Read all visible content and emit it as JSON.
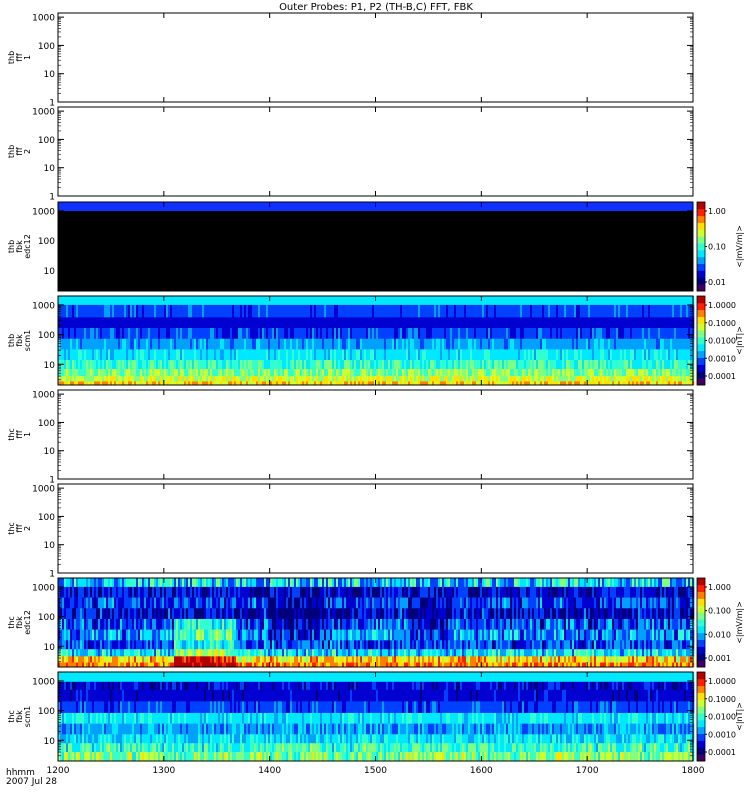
{
  "title": "Outer Probes: P1, P2 (TH-B,C) FFT, FBK",
  "xaxis": {
    "range": [
      1200,
      1800
    ],
    "ticks": [
      "1200",
      "1300",
      "1400",
      "1500",
      "1600",
      "1700",
      "1800"
    ],
    "label_line1": "hhmm",
    "label_line2": "2007 Jul 28"
  },
  "chart_data": [
    {
      "type": "heatmap",
      "name_lines": [
        "thb",
        "fff",
        "1"
      ],
      "yticks": [
        "1",
        "10",
        "100",
        "1000"
      ],
      "ylim": [
        1,
        1400
      ],
      "fill": "none",
      "colorbar": null
    },
    {
      "type": "heatmap",
      "name_lines": [
        "thb",
        "fff",
        "2"
      ],
      "yticks": [
        "1",
        "10",
        "100",
        "1000"
      ],
      "ylim": [
        1,
        1400
      ],
      "fill": "none",
      "colorbar": null
    },
    {
      "type": "heatmap",
      "name_lines": [
        "thb",
        "fbk",
        "edc12"
      ],
      "yticks": [
        "10",
        "100",
        "1000"
      ],
      "ylim": [
        2,
        2000
      ],
      "fill": "edc_black",
      "colorbar": {
        "ticks": [
          "1.00",
          "0.10",
          "0.01"
        ],
        "unit": "<|mV/m|>"
      }
    },
    {
      "type": "heatmap",
      "name_lines": [
        "thb",
        "fbk",
        "scm1"
      ],
      "yticks": [
        "10",
        "100",
        "1000"
      ],
      "ylim": [
        2,
        2000
      ],
      "fill": "scm_b",
      "colorbar": {
        "ticks": [
          "1.0000",
          "0.1000",
          "0.0100",
          "0.0010",
          "0.0001"
        ],
        "unit": "<|nT|>"
      }
    },
    {
      "type": "heatmap",
      "name_lines": [
        "thc",
        "fff",
        "1"
      ],
      "yticks": [
        "1",
        "10",
        "100",
        "1000"
      ],
      "ylim": [
        1,
        1400
      ],
      "fill": "none",
      "colorbar": null
    },
    {
      "type": "heatmap",
      "name_lines": [
        "thc",
        "fff",
        "2"
      ],
      "yticks": [
        "1",
        "10",
        "100",
        "1000"
      ],
      "ylim": [
        1,
        1400
      ],
      "fill": "none",
      "colorbar": null
    },
    {
      "type": "heatmap",
      "name_lines": [
        "thc",
        "fbk",
        "edc12"
      ],
      "yticks": [
        "10",
        "100",
        "1000"
      ],
      "ylim": [
        2,
        2000
      ],
      "fill": "edc_c",
      "colorbar": {
        "ticks": [
          "1.000",
          "0.100",
          "0.010",
          "0.001"
        ],
        "unit": "<|mV/m|>"
      }
    },
    {
      "type": "heatmap",
      "name_lines": [
        "thc",
        "fbk",
        "scm1"
      ],
      "yticks": [
        "10",
        "100",
        "1000"
      ],
      "ylim": [
        2,
        2000
      ],
      "fill": "scm_c",
      "colorbar": {
        "ticks": [
          "1.0000",
          "0.1000",
          "0.0100",
          "0.0010",
          "0.0001"
        ],
        "unit": "<|nT|>"
      }
    }
  ]
}
